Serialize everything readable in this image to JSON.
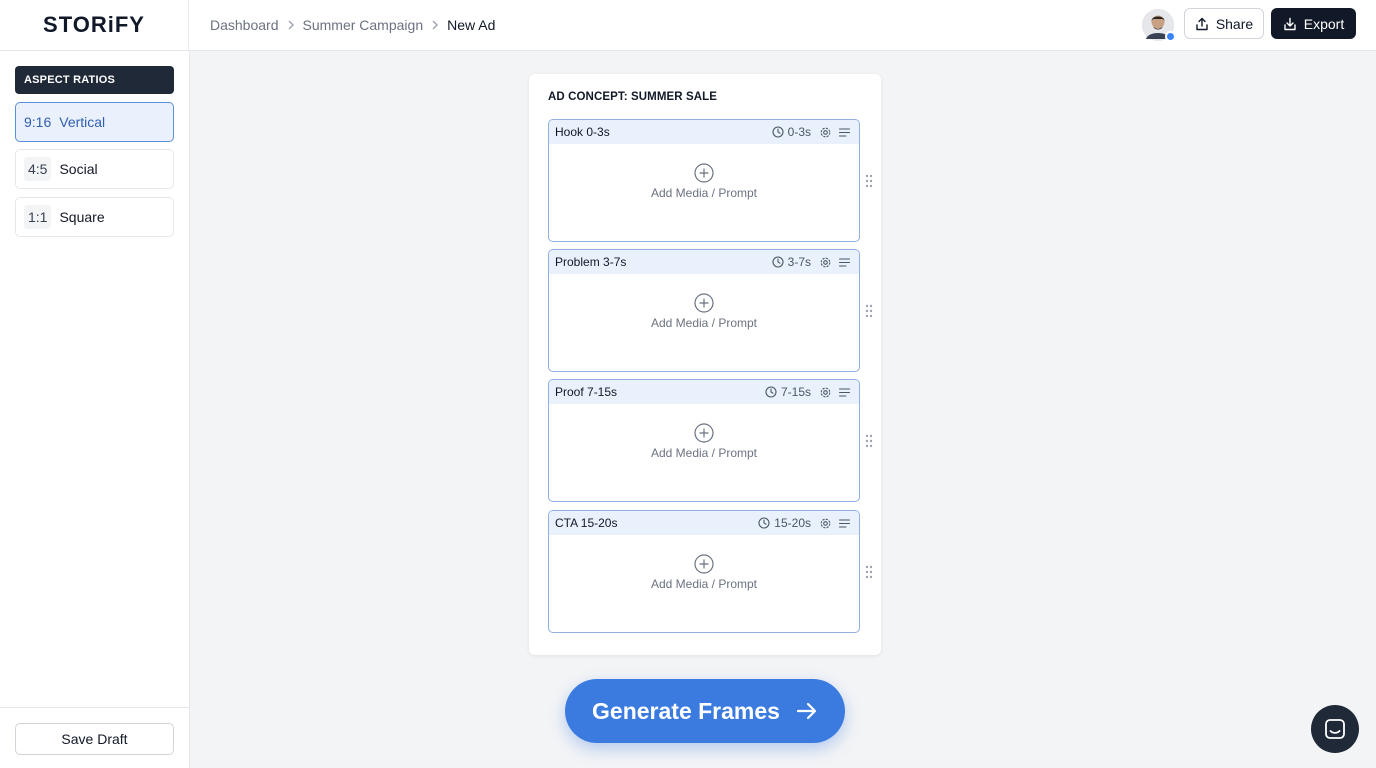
{
  "app": {
    "logo": "STORiFY"
  },
  "breadcrumb": [
    {
      "label": "Dashboard"
    },
    {
      "label": "Summer Campaign"
    },
    {
      "label": "New Ad"
    }
  ],
  "header": {
    "share_label": "Share",
    "export_label": "Export"
  },
  "sidebar": {
    "section_title": "ASPECT RATIOS",
    "ratios": [
      {
        "ratio": "9:16",
        "label": "Vertical",
        "selected": true
      },
      {
        "ratio": "4:5",
        "label": "Social",
        "selected": false
      },
      {
        "ratio": "1:1",
        "label": "Square",
        "selected": false
      }
    ],
    "save_label": "Save Draft"
  },
  "concept": {
    "title": "AD CONCEPT: SUMMER SALE",
    "scenes": [
      {
        "name": "Hook 0-3s",
        "time": "0-3s",
        "add_label": "Add Media / Prompt"
      },
      {
        "name": "Problem 3-7s",
        "time": "3-7s",
        "add_label": "Add Media / Prompt"
      },
      {
        "name": "Proof 7-15s",
        "time": "7-15s",
        "add_label": "Add Media / Prompt"
      },
      {
        "name": "CTA 15-20s",
        "time": "15-20s",
        "add_label": "Add Media / Prompt"
      }
    ]
  },
  "actions": {
    "generate_label": "Generate Frames"
  },
  "theme": {
    "accent": "#3b7be0",
    "dark": "#111827",
    "selected_bg": "#eaf1fc"
  },
  "icons": [
    "share-icon",
    "export-icon",
    "clock-icon",
    "gear-icon",
    "menu-icon",
    "plus-circle-icon",
    "drag-handle-icon",
    "arrow-right-icon",
    "chat-icon",
    "chevron-right-icon"
  ]
}
